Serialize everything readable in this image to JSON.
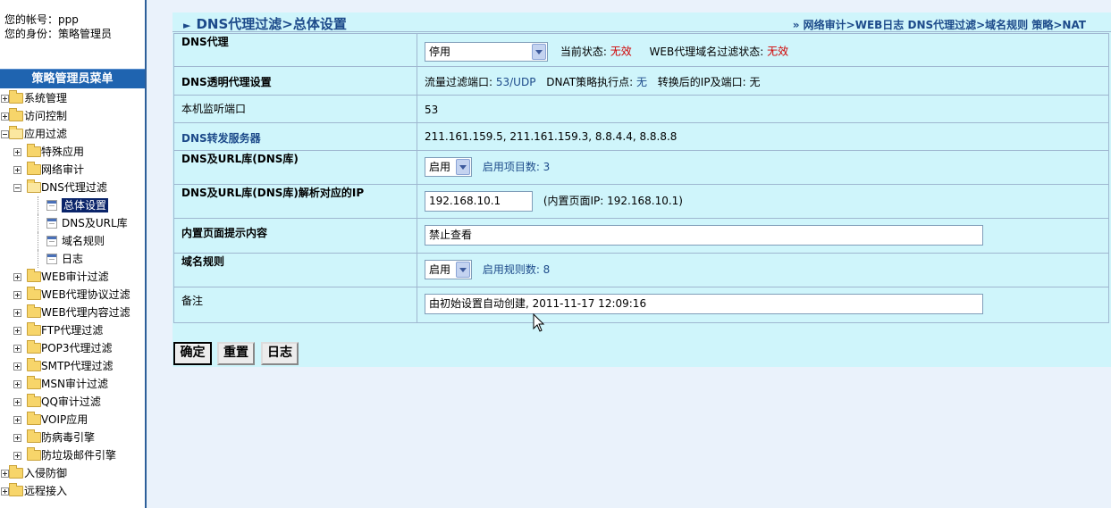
{
  "user": {
    "account_label": "您的帐号：ppp",
    "role_label": "您的身份：策略管理员"
  },
  "menu": {
    "header": "策略管理员菜单",
    "items": [
      {
        "label": "系统管理",
        "level": 0,
        "type": "folder"
      },
      {
        "label": "访问控制",
        "level": 0,
        "type": "folder"
      },
      {
        "label": "应用过滤",
        "level": 0,
        "type": "folder-open"
      },
      {
        "label": "特殊应用",
        "level": 1,
        "type": "folder"
      },
      {
        "label": "网络审计",
        "level": 1,
        "type": "folder"
      },
      {
        "label": "DNS代理过滤",
        "level": 1,
        "type": "folder-open"
      },
      {
        "label": "总体设置",
        "level": 2,
        "type": "page",
        "selected": true
      },
      {
        "label": "DNS及URL库",
        "level": 2,
        "type": "page"
      },
      {
        "label": "域名规则",
        "level": 2,
        "type": "page"
      },
      {
        "label": "日志",
        "level": 2,
        "type": "page"
      },
      {
        "label": "WEB审计过滤",
        "level": 1,
        "type": "folder"
      },
      {
        "label": "WEB代理协议过滤",
        "level": 1,
        "type": "folder"
      },
      {
        "label": "WEB代理内容过滤",
        "level": 1,
        "type": "folder"
      },
      {
        "label": "FTP代理过滤",
        "level": 1,
        "type": "folder"
      },
      {
        "label": "POP3代理过滤",
        "level": 1,
        "type": "folder"
      },
      {
        "label": "SMTP代理过滤",
        "level": 1,
        "type": "folder"
      },
      {
        "label": "MSN审计过滤",
        "level": 1,
        "type": "folder"
      },
      {
        "label": "QQ审计过滤",
        "level": 1,
        "type": "folder"
      },
      {
        "label": "VOIP应用",
        "level": 1,
        "type": "folder"
      },
      {
        "label": "防病毒引擎",
        "level": 1,
        "type": "folder"
      },
      {
        "label": "防垃圾邮件引擎",
        "level": 1,
        "type": "folder"
      },
      {
        "label": "入侵防御",
        "level": 0,
        "type": "folder"
      },
      {
        "label": "远程接入",
        "level": 0,
        "type": "folder"
      }
    ]
  },
  "page": {
    "title": "DNS代理过滤>总体设置",
    "breadcrumb": "»  网络审计>WEB日志  DNS代理过滤>域名规则  策略>NAT"
  },
  "form": {
    "dns_proxy": {
      "label": "DNS代理",
      "value": "停用",
      "status_label": "当前状态:",
      "status_value": "无效",
      "web_status_label": "WEB代理域名过滤状态:",
      "web_status_value": "无效"
    },
    "transparent": {
      "label": "DNS透明代理设置",
      "port_label": "流量过滤端口: ",
      "port_value": "53/UDP",
      "dnat_label": "DNAT策略执行点: ",
      "dnat_value": "无",
      "converted_label": "转换后的IP及端口: ",
      "converted_value": "无"
    },
    "listen_port": {
      "label": "本机监听端口",
      "value": "53"
    },
    "forward": {
      "label": "DNS转发服务器",
      "value": "211.161.159.5, 211.161.159.3, 8.8.4.4, 8.8.8.8"
    },
    "dns_url_lib": {
      "label": "DNS及URL库(DNS库)",
      "value": "启用",
      "count_text": "启用项目数: 3"
    },
    "resolve_ip": {
      "label": "DNS及URL库(DNS库)解析对应的IP",
      "value": "192.168.10.1",
      "note": "(内置页面IP: 192.168.10.1)"
    },
    "builtin_page": {
      "label": "内置页面提示内容",
      "value": "禁止查看"
    },
    "domain_rules": {
      "label": "域名规则",
      "value": "启用",
      "count_text": "启用规则数: 8"
    },
    "remark": {
      "label": "备注",
      "value": "由初始设置自动创建, 2011-11-17 12:09:16"
    }
  },
  "buttons": {
    "ok": "确定",
    "reset": "重置",
    "log": "日志"
  },
  "colors": {
    "menu_header": "#1f64b0",
    "panel": "#cff5fb",
    "invalid": "#d00000",
    "link": "#1c4a8a"
  }
}
